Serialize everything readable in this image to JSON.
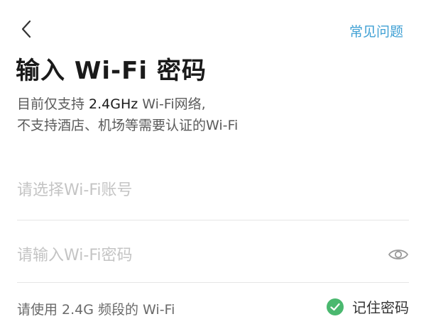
{
  "header": {
    "back_icon": "chevron-left-icon",
    "faq_label": "常见问题"
  },
  "title": "输入 Wi-Fi 密码",
  "description": {
    "line1_prefix": "目前仅支持 ",
    "line1_highlight": "2.4GHz",
    "line1_suffix": " Wi-Fi网络,",
    "line2": "不支持酒店、机场等需要认证的Wi-Fi"
  },
  "form": {
    "ssid_placeholder": "请选择Wi-Fi账号",
    "ssid_value": "",
    "password_placeholder": "请输入Wi-Fi密码",
    "password_value": "",
    "visibility_icon": "eye-icon"
  },
  "footer": {
    "hint": "请使用 2.4G 频段的 Wi-Fi",
    "remember_label": "记住密码",
    "remember_checked": true
  },
  "colors": {
    "accent_link": "#3fa0d4",
    "check_green": "#4ab86f",
    "title_text": "#1a1a1a",
    "placeholder": "#c4c4c4"
  }
}
